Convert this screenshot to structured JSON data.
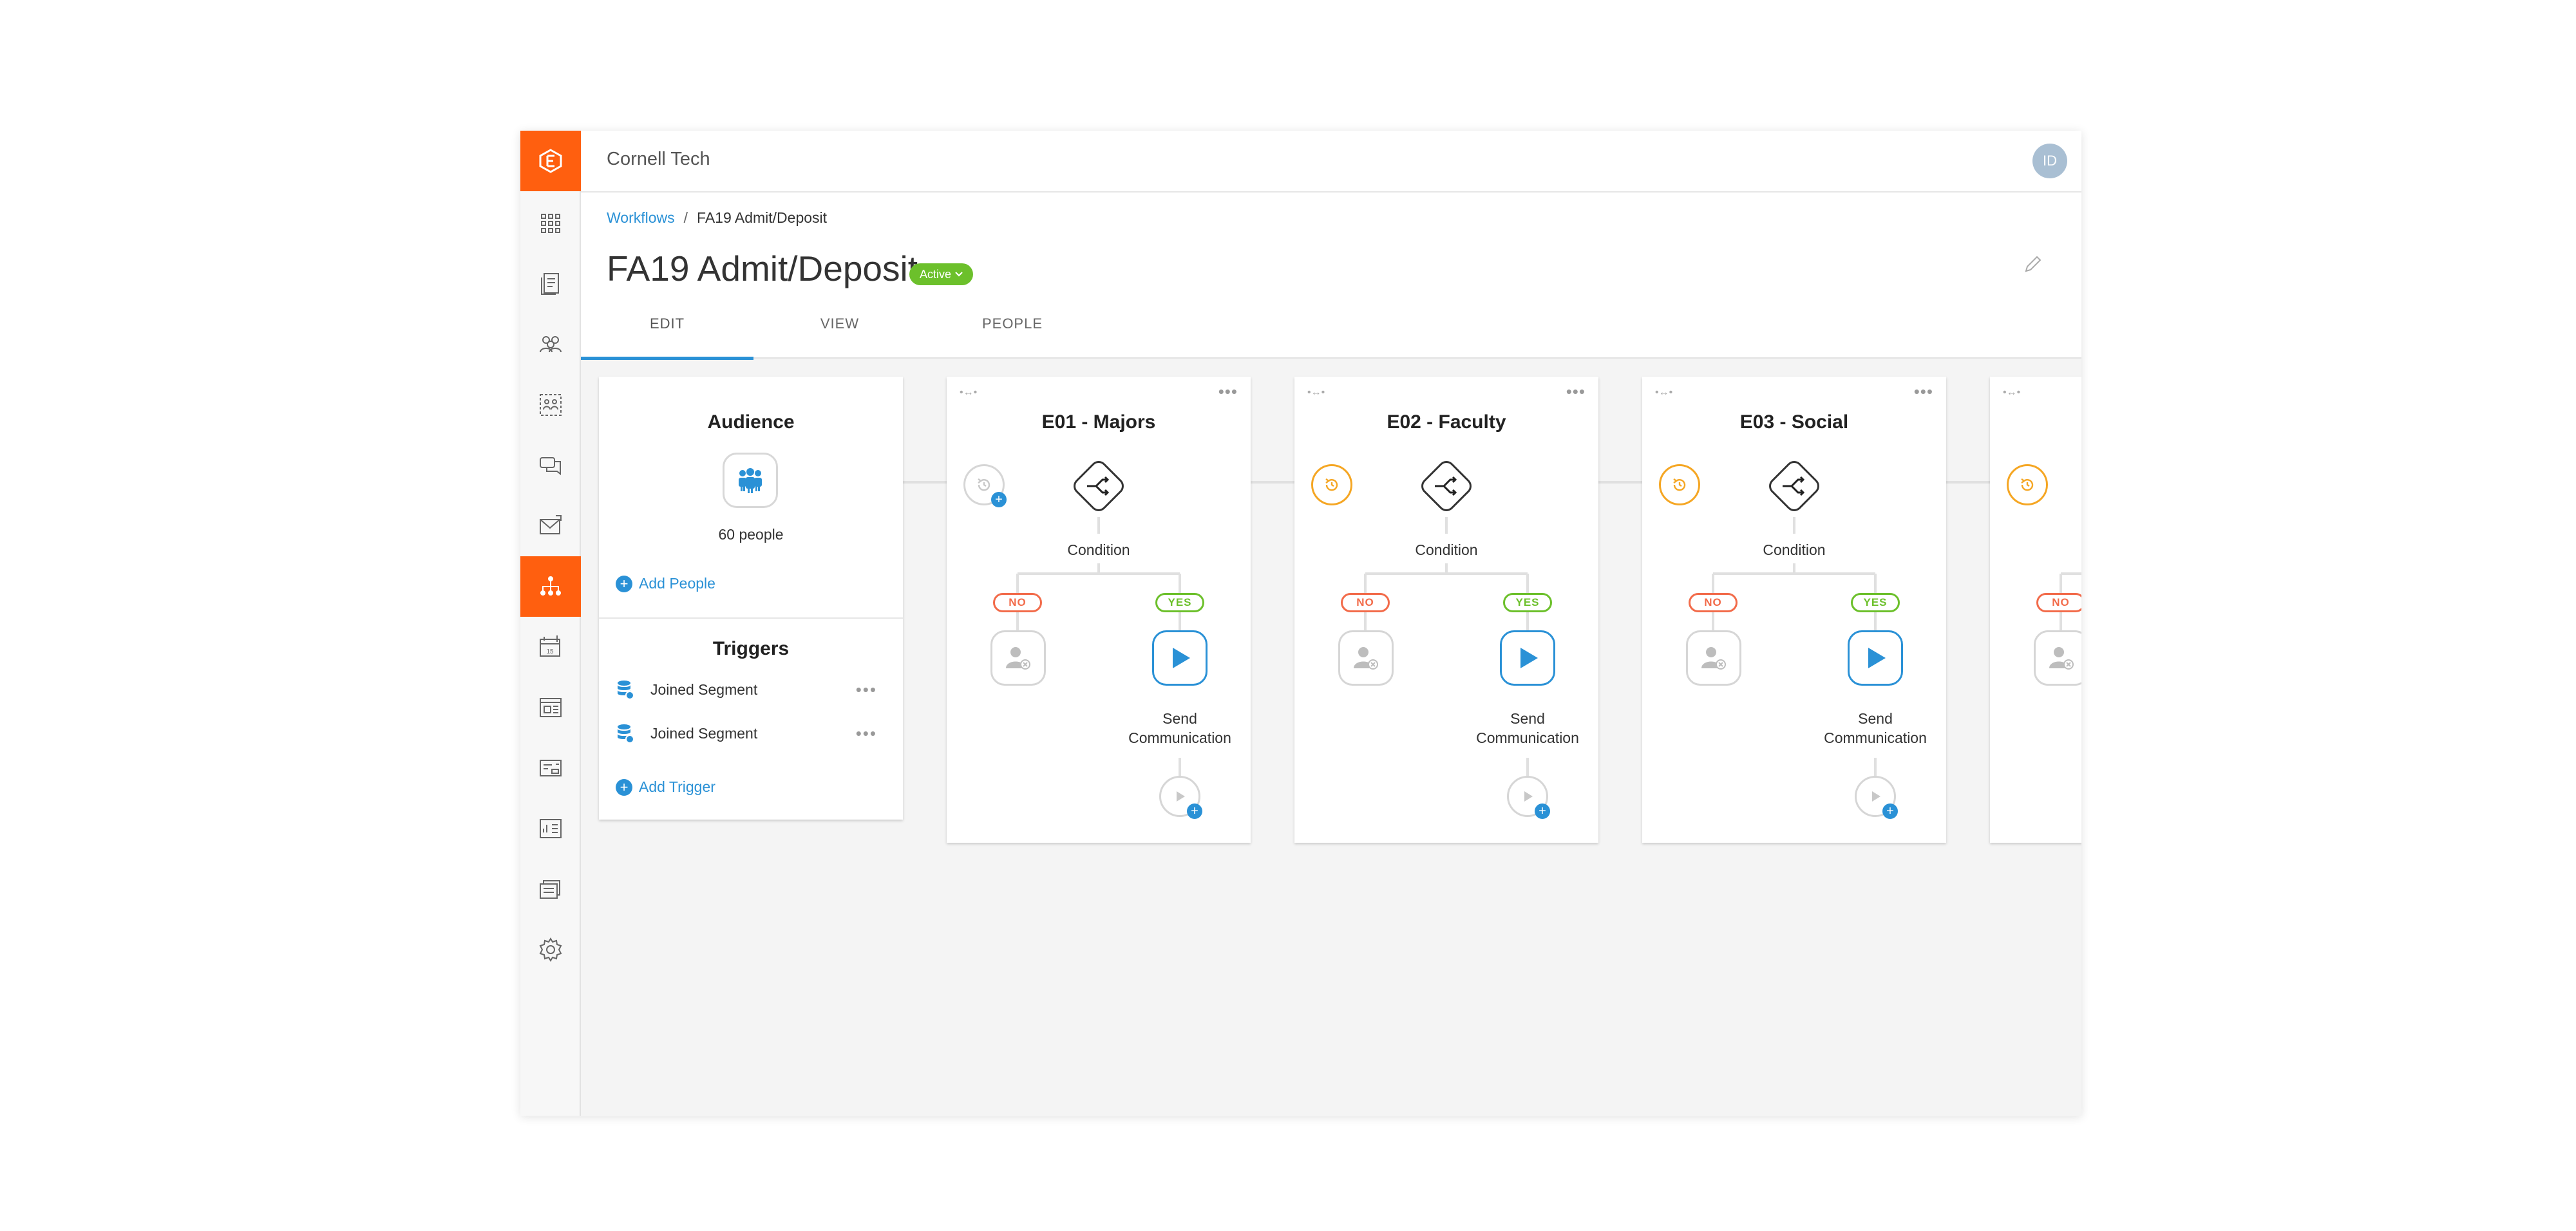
{
  "org_name": "Cornell Tech",
  "user_initials": "ID",
  "breadcrumb": {
    "parent": "Workflows",
    "separator": "/",
    "current": "FA19 Admit/Deposit"
  },
  "page_title": "FA19 Admit/Deposit",
  "status_badge": "Active",
  "tabs": [
    {
      "label": "EDIT"
    },
    {
      "label": "VIEW"
    },
    {
      "label": "PEOPLE"
    }
  ],
  "audience": {
    "title": "Audience",
    "count_label": "60 people",
    "add_people": "Add People"
  },
  "triggers": {
    "title": "Triggers",
    "items": [
      {
        "label": "Joined Segment"
      },
      {
        "label": "Joined Segment"
      }
    ],
    "add_trigger": "Add Trigger",
    "more": "•••"
  },
  "emails": [
    {
      "title": "E01 - Majors",
      "condition": "Condition",
      "no": "NO",
      "yes": "YES",
      "send_line1": "Send",
      "send_line2": "Communication",
      "wait_color": "grey"
    },
    {
      "title": "E02 - Faculty",
      "condition": "Condition",
      "no": "NO",
      "yes": "YES",
      "send_line1": "Send",
      "send_line2": "Communication",
      "wait_color": "orange"
    },
    {
      "title": "E03 - Social",
      "condition": "Condition",
      "no": "NO",
      "yes": "YES",
      "send_line1": "Send",
      "send_line2": "Communication",
      "wait_color": "orange"
    },
    {
      "title": "",
      "condition": "",
      "no": "NO",
      "yes": "",
      "send_line1": "",
      "send_line2": "",
      "wait_color": "orange"
    }
  ],
  "card_more": "•••",
  "colors": {
    "brand": "#ff5f0f",
    "link": "#2a91d6",
    "active": "#6cc02b",
    "no": "#f26b4a",
    "yes": "#6cc02b",
    "wait": "#f5a623"
  }
}
